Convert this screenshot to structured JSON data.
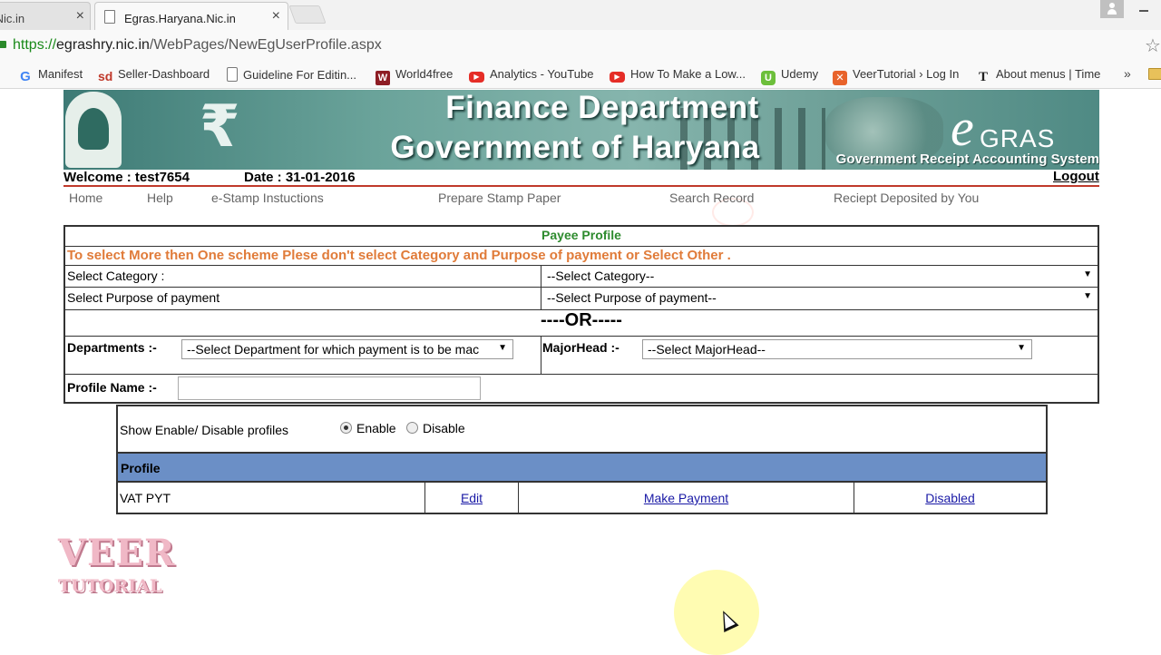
{
  "browser": {
    "tabs": [
      {
        "label": ".Nic.in",
        "active": false
      },
      {
        "label": "Egras.Haryana.Nic.in",
        "active": true
      }
    ],
    "address": {
      "scheme": "https://",
      "host": "egrashry.nic.in",
      "path": "/WebPages/NewEgUserProfile.aspx"
    },
    "bookmarks": [
      {
        "label": "Manifest",
        "icon": "google-icon"
      },
      {
        "label": "Seller-Dashboard",
        "icon": "sd-icon"
      },
      {
        "label": "Guideline For Editin...",
        "icon": "document-icon"
      },
      {
        "label": "World4free",
        "icon": "w-icon"
      },
      {
        "label": "Analytics - YouTube",
        "icon": "youtube-icon"
      },
      {
        "label": "How To Make a Low...",
        "icon": "youtube-icon"
      },
      {
        "label": "Udemy",
        "icon": "udemy-icon"
      },
      {
        "label": "VeerTutorial › Log In",
        "icon": "veertutorial-icon"
      },
      {
        "label": "About menus | Time",
        "icon": "t-icon"
      }
    ],
    "more": "»"
  },
  "banner": {
    "title_line1": "Finance Department",
    "title_line2": "Government of Haryana",
    "logo_e": "e",
    "logo_gras": "GRAS",
    "tagline": "Government Receipt Accounting System"
  },
  "header": {
    "welcome": "Welcome : test7654",
    "date": "Date : 31-01-2016",
    "logout": "Logout"
  },
  "nav": {
    "items": [
      "Home",
      "Help",
      "e-Stamp Instuctions",
      "Prepare Stamp Paper",
      "Search Record",
      "Reciept Deposited by You"
    ]
  },
  "form": {
    "title": "Payee Profile",
    "warning": "To select More then One scheme Plese don't select Category and Purpose of payment or Select Other .",
    "category_label": "Select Category :",
    "category_value": "--Select Category--",
    "purpose_label": "Select Purpose of payment",
    "purpose_value": "--Select Purpose of payment--",
    "or_text": "----OR-----",
    "departments_label": "Departments :-",
    "departments_value": "--Select Department for which payment is to be mac",
    "majorhead_label": "MajorHead :-",
    "majorhead_value": "--Select MajorHead--",
    "profile_name_label": "Profile Name :-",
    "profile_name_value": ""
  },
  "profiles": {
    "show_label": "Show Enable/ Disable profiles",
    "enable_label": "Enable",
    "disable_label": "Disable",
    "enable_selected": true,
    "header": "Profile",
    "rows": [
      {
        "name": "VAT PYT",
        "edit": "Edit",
        "pay": "Make Payment",
        "status": "Disabled"
      }
    ]
  },
  "watermark": {
    "line1": "VEER",
    "line2": "TUTORIAL"
  },
  "colors": {
    "warning": "#e07b39",
    "title_green": "#2e8b2e",
    "header_blue": "#6b8fc6",
    "rule_red": "#c0392b",
    "link_blue": "#1a1aa6"
  }
}
